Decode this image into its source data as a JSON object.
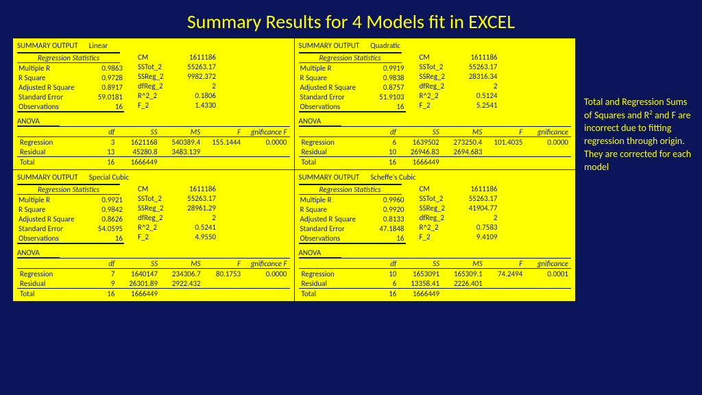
{
  "title": "Summary Results for 4 Models fit in EXCEL",
  "side_note": "Total and Regression Sums of Squares and R² and F are incorrect due to fitting regression through origin. They are corrected for each model",
  "labels": {
    "so": "SUMMARY OUTPUT",
    "rs": "Regression Statistics",
    "mr": "Multiple R",
    "r2": "R Square",
    "ar": "Adjusted R Square",
    "se": "Standard Error",
    "ob": "Observations",
    "an": "ANOVA",
    "df": "df",
    "ss": "SS",
    "ms": "MS",
    "f": "F",
    "sf": "gnificance F",
    "sf2": "gnificance",
    "reg": "Regression",
    "res": "Residual",
    "tot": "Total",
    "cm": "CM",
    "sst": "SSTot_2",
    "ssr": "SSReg_2",
    "dfr": "dfReg_2",
    "r22": "R^2_2",
    "f2": "F_2"
  },
  "panels": [
    {
      "name": "Linear",
      "stats": {
        "mr": "0.9863",
        "r2": "0.9728",
        "ar": "0.8917",
        "se": "59.0181",
        "ob": "16"
      },
      "side": {
        "cm": "1611186",
        "sst": "55263.17",
        "ssr": "9982.372",
        "dfr": "2",
        "r22": "0.1806",
        "f2": "1.4330"
      },
      "anova": [
        [
          "Regression",
          "3",
          "1621168",
          "540389.4",
          "155.1444",
          "0.0000"
        ],
        [
          "Residual",
          "13",
          "45280.8",
          "3483.139",
          "",
          ""
        ],
        [
          "Total",
          "16",
          "1666449",
          "",
          "",
          ""
        ]
      ],
      "sigf": "gnificance F"
    },
    {
      "name": "Quadratic",
      "stats": {
        "mr": "0.9919",
        "r2": "0.9838",
        "ar": "0.8757",
        "se": "51.9103",
        "ob": "16"
      },
      "side": {
        "cm": "1611186",
        "sst": "55263.17",
        "ssr": "28316.34",
        "dfr": "2",
        "r22": "0.5124",
        "f2": "5.2541"
      },
      "anova": [
        [
          "Regression",
          "6",
          "1639502",
          "273250.4",
          "101.4035",
          "0.0000"
        ],
        [
          "Residual",
          "10",
          "26946.83",
          "2694.683",
          "",
          ""
        ],
        [
          "Total",
          "16",
          "1666449",
          "",
          "",
          ""
        ]
      ],
      "sigf": "gnificance"
    },
    {
      "name": "Special Cubic",
      "stats": {
        "mr": "0.9921",
        "r2": "0.9842",
        "ar": "0.8626",
        "se": "54.0595",
        "ob": "16"
      },
      "side": {
        "cm": "1611186",
        "sst": "55263.17",
        "ssr": "28961.29",
        "dfr": "2",
        "r22": "0.5241",
        "f2": "4.9550"
      },
      "anova": [
        [
          "Regression",
          "7",
          "1640147",
          "234306.7",
          "80.1753",
          "0.0000"
        ],
        [
          "Residual",
          "9",
          "26301.89",
          "2922.432",
          "",
          ""
        ],
        [
          "Total",
          "16",
          "1666449",
          "",
          "",
          ""
        ]
      ],
      "sigf": "gnificance F"
    },
    {
      "name": "Scheffe's Cubic",
      "stats": {
        "mr": "0.9960",
        "r2": "0.9920",
        "ar": "0.8133",
        "se": "47.1848",
        "ob": "16"
      },
      "side": {
        "cm": "1611186",
        "sst": "55263.17",
        "ssr": "41904.77",
        "dfr": "2",
        "r22": "0.7583",
        "f2": "9.4109"
      },
      "anova": [
        [
          "Regression",
          "10",
          "1653091",
          "165309.1",
          "74.2494",
          "0.0001"
        ],
        [
          "Residual",
          "6",
          "13358.41",
          "2226.401",
          "",
          ""
        ],
        [
          "Total",
          "16",
          "1666449",
          "",
          "",
          ""
        ]
      ],
      "sigf": "gnificance"
    }
  ]
}
